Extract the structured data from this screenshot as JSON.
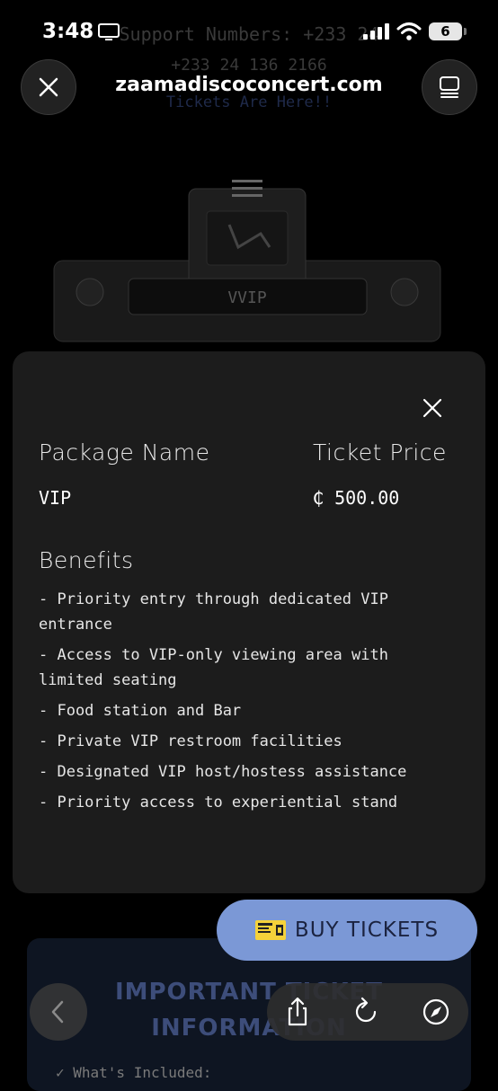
{
  "status_bar": {
    "time": "3:48",
    "battery": "6"
  },
  "browser": {
    "url": "zaamadiscoconcert.com"
  },
  "background": {
    "support_text": "Support Numbers: +233 24",
    "phone_text": "+233 24 136 2166",
    "tickets_here": "Tickets Are Here!!",
    "hero_label": "VVIP"
  },
  "modal": {
    "package_label": "Package Name",
    "price_label": "Ticket Price",
    "package_value": "VIP",
    "price_value": "₵ 500.00",
    "benefits_label": "Benefits",
    "benefits": [
      "- Priority entry through dedicated VIP entrance",
      "- Access to VIP-only viewing area with limited seating",
      "- Food station and Bar",
      "- Private VIP restroom facilities",
      "- Designated VIP host/hostess assistance",
      "- Priority access to experiential stand"
    ]
  },
  "page": {
    "info_title_line1": "IMPORTANT TICKET",
    "info_title_line2": "INFORMATION",
    "whats_included": "✓ What's Included:"
  },
  "buy_button": {
    "label": "BUY TICKETS"
  },
  "colors": {
    "accent": "#7b98d6",
    "modal_bg": "#1c1c1c"
  },
  "icons": {
    "close": "close-icon",
    "tabs": "tabs-icon",
    "back": "chevron-left-icon",
    "share": "share-icon",
    "reload": "reload-icon",
    "compass": "compass-icon"
  }
}
